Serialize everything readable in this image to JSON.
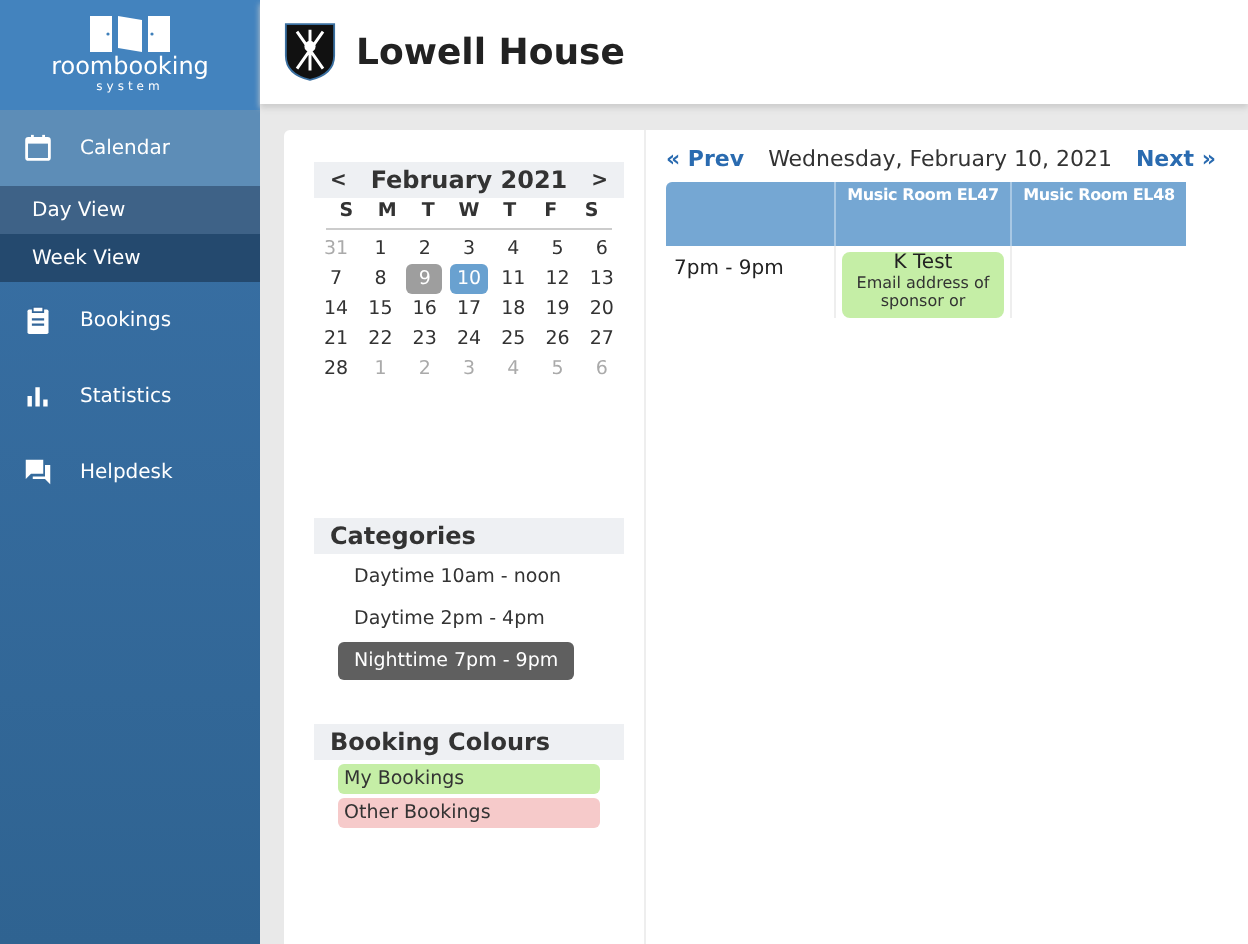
{
  "brand": {
    "name": "roombooking",
    "tagline": "system"
  },
  "nav": [
    {
      "label": "Calendar",
      "kind": "calendar",
      "selected": true,
      "children": [
        {
          "label": "Day View",
          "selected": true
        },
        {
          "label": "Week View",
          "selected": false
        }
      ]
    },
    {
      "label": "Bookings",
      "kind": "clipboard",
      "selected": false
    },
    {
      "label": "Statistics",
      "kind": "bars",
      "selected": false
    },
    {
      "label": "Helpdesk",
      "kind": "chat",
      "selected": false
    }
  ],
  "header": {
    "title": "Lowell House"
  },
  "mini_calendar": {
    "prev": "<",
    "title": "February 2021",
    "next": ">",
    "weekdays": [
      "S",
      "M",
      "T",
      "W",
      "T",
      "F",
      "S"
    ],
    "weeks": [
      [
        {
          "label": "31",
          "muted": true,
          "selected": false,
          "marked": false
        },
        {
          "label": "1",
          "muted": false,
          "selected": false,
          "marked": false
        },
        {
          "label": "2",
          "muted": false,
          "selected": false,
          "marked": false
        },
        {
          "label": "3",
          "muted": false,
          "selected": false,
          "marked": false
        },
        {
          "label": "4",
          "muted": false,
          "selected": false,
          "marked": false
        },
        {
          "label": "5",
          "muted": false,
          "selected": false,
          "marked": false
        },
        {
          "label": "6",
          "muted": false,
          "selected": false,
          "marked": false
        }
      ],
      [
        {
          "label": "7",
          "muted": false,
          "selected": false,
          "marked": false
        },
        {
          "label": "8",
          "muted": false,
          "selected": false,
          "marked": false
        },
        {
          "label": "9",
          "muted": false,
          "selected": false,
          "marked": true
        },
        {
          "label": "10",
          "muted": false,
          "selected": true,
          "marked": false
        },
        {
          "label": "11",
          "muted": false,
          "selected": false,
          "marked": false
        },
        {
          "label": "12",
          "muted": false,
          "selected": false,
          "marked": false
        },
        {
          "label": "13",
          "muted": false,
          "selected": false,
          "marked": false
        }
      ],
      [
        {
          "label": "14",
          "muted": false,
          "selected": false,
          "marked": false
        },
        {
          "label": "15",
          "muted": false,
          "selected": false,
          "marked": false
        },
        {
          "label": "16",
          "muted": false,
          "selected": false,
          "marked": false
        },
        {
          "label": "17",
          "muted": false,
          "selected": false,
          "marked": false
        },
        {
          "label": "18",
          "muted": false,
          "selected": false,
          "marked": false
        },
        {
          "label": "19",
          "muted": false,
          "selected": false,
          "marked": false
        },
        {
          "label": "20",
          "muted": false,
          "selected": false,
          "marked": false
        }
      ],
      [
        {
          "label": "21",
          "muted": false,
          "selected": false,
          "marked": false
        },
        {
          "label": "22",
          "muted": false,
          "selected": false,
          "marked": false
        },
        {
          "label": "23",
          "muted": false,
          "selected": false,
          "marked": false
        },
        {
          "label": "24",
          "muted": false,
          "selected": false,
          "marked": false
        },
        {
          "label": "25",
          "muted": false,
          "selected": false,
          "marked": false
        },
        {
          "label": "26",
          "muted": false,
          "selected": false,
          "marked": false
        },
        {
          "label": "27",
          "muted": false,
          "selected": false,
          "marked": false
        }
      ],
      [
        {
          "label": "28",
          "muted": false,
          "selected": false,
          "marked": false
        },
        {
          "label": "1",
          "muted": true,
          "selected": false,
          "marked": false
        },
        {
          "label": "2",
          "muted": true,
          "selected": false,
          "marked": false
        },
        {
          "label": "3",
          "muted": true,
          "selected": false,
          "marked": false
        },
        {
          "label": "4",
          "muted": true,
          "selected": false,
          "marked": false
        },
        {
          "label": "5",
          "muted": true,
          "selected": false,
          "marked": false
        },
        {
          "label": "6",
          "muted": true,
          "selected": false,
          "marked": false
        }
      ]
    ]
  },
  "categories": {
    "title": "Categories",
    "items": [
      {
        "label": "Daytime 10am - noon",
        "selected": false
      },
      {
        "label": "Daytime 2pm - 4pm",
        "selected": false
      },
      {
        "label": "Nighttime 7pm - 9pm",
        "selected": true
      }
    ]
  },
  "booking_colours": {
    "title": "Booking Colours",
    "items": [
      {
        "label": "My Bookings",
        "color": "#c5eea6"
      },
      {
        "label": "Other Bookings",
        "color": "#f6caca"
      }
    ]
  },
  "day_nav": {
    "prev": "« Prev",
    "date": "Wednesday, February 10, 2021",
    "next": "Next »"
  },
  "schedule": {
    "columns": [
      "Music Room EL47",
      "Music Room EL48"
    ],
    "rows": [
      {
        "time": "7pm - 9pm",
        "cells": [
          {
            "title": "K Test",
            "detail": "Email address of sponsor or",
            "color": "#c5eea6"
          },
          null
        ]
      }
    ]
  }
}
